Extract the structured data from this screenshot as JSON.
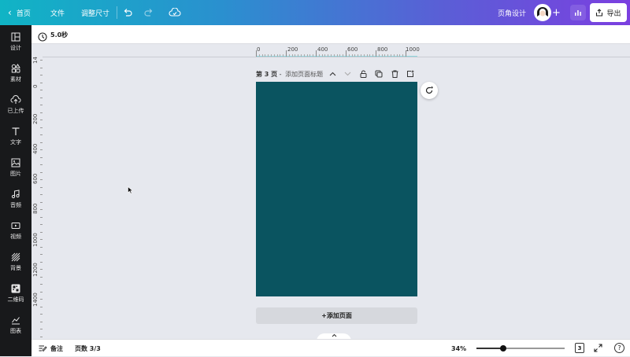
{
  "topbar": {
    "home_label": "首页",
    "file_label": "文件",
    "resize_label": "调整尺寸",
    "design_title": "页角设计",
    "export_label": "导出"
  },
  "sidebar": {
    "items": [
      {
        "label": "设计",
        "icon": "layout-icon"
      },
      {
        "label": "素材",
        "icon": "elements-icon"
      },
      {
        "label": "已上传",
        "icon": "upload-cloud-icon"
      },
      {
        "label": "文字",
        "icon": "text-icon"
      },
      {
        "label": "图片",
        "icon": "image-icon"
      },
      {
        "label": "音频",
        "icon": "music-icon"
      },
      {
        "label": "视频",
        "icon": "video-icon"
      },
      {
        "label": "背景",
        "icon": "background-icon"
      },
      {
        "label": "二维码",
        "icon": "qrcode-icon"
      },
      {
        "label": "图表",
        "icon": "chart-icon"
      }
    ]
  },
  "subbar": {
    "duration": "5.0秒"
  },
  "ruler": {
    "horizontal": [
      "0",
      "200",
      "400",
      "600",
      "800",
      "1000"
    ],
    "vertical": [
      "14",
      "0",
      "200",
      "400",
      "600",
      "800",
      "1000",
      "1200",
      "1400"
    ]
  },
  "page": {
    "number_label": "第 3 页",
    "separator": " - ",
    "title_placeholder": "添加页面标题",
    "fill_color": "#0a5460"
  },
  "canvas": {
    "add_page_label": "+添加页面"
  },
  "bottombar": {
    "notes_label": "备注",
    "page_count_label": "页数 3/3",
    "zoom_label": "34%",
    "zoom_level": 0.3,
    "page_grid_count": "3",
    "help_label": "?"
  },
  "colors": {
    "gradient_start": "#10b4c5",
    "gradient_end": "#7b3fe0",
    "sidebar_bg": "#18191b",
    "page_fill": "#0a5460"
  }
}
